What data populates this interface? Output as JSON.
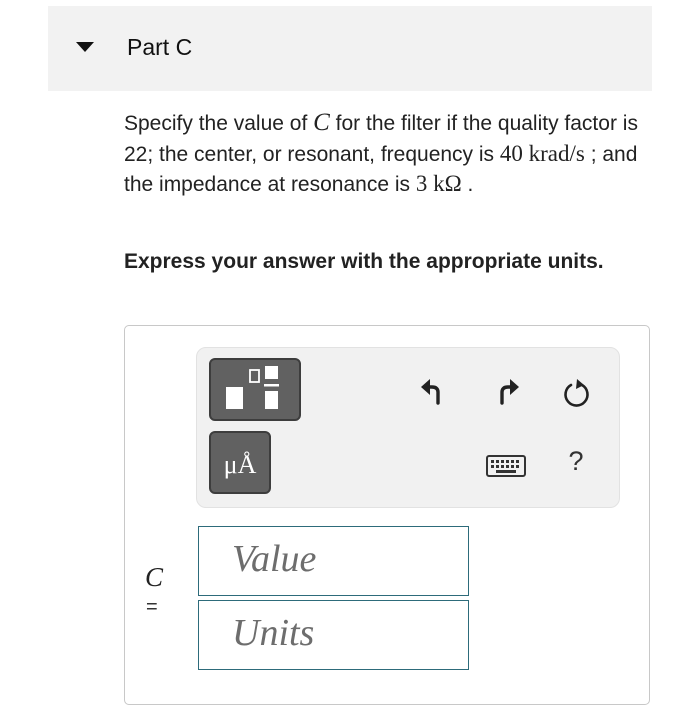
{
  "part": {
    "title": "Part C"
  },
  "question": {
    "pre": "Specify the value of ",
    "var": "C",
    "post1": " for the filter if the quality factor is 22; the center, or resonant, frequency is ",
    "freq": "40 krad/s",
    "post2": " ; and the impedance at resonance is ",
    "imp": "3 kΩ",
    "end": " ."
  },
  "instruction": "Express your answer with the appropriate units.",
  "toolbar": {
    "units_button_label": "μÅ",
    "help_label": "?",
    "icons": [
      "templates-icon",
      "units-icon",
      "undo-icon",
      "redo-icon",
      "reset-icon",
      "keyboard-icon",
      "help-icon"
    ]
  },
  "answer": {
    "variable": "C",
    "equals": "=",
    "value_placeholder": "Value",
    "units_placeholder": "Units"
  },
  "colors": {
    "header_bg": "#f2f2f2",
    "toolbar_bg": "#f1f1f1",
    "button_bg": "#616161",
    "field_border": "#2d6b7a"
  }
}
